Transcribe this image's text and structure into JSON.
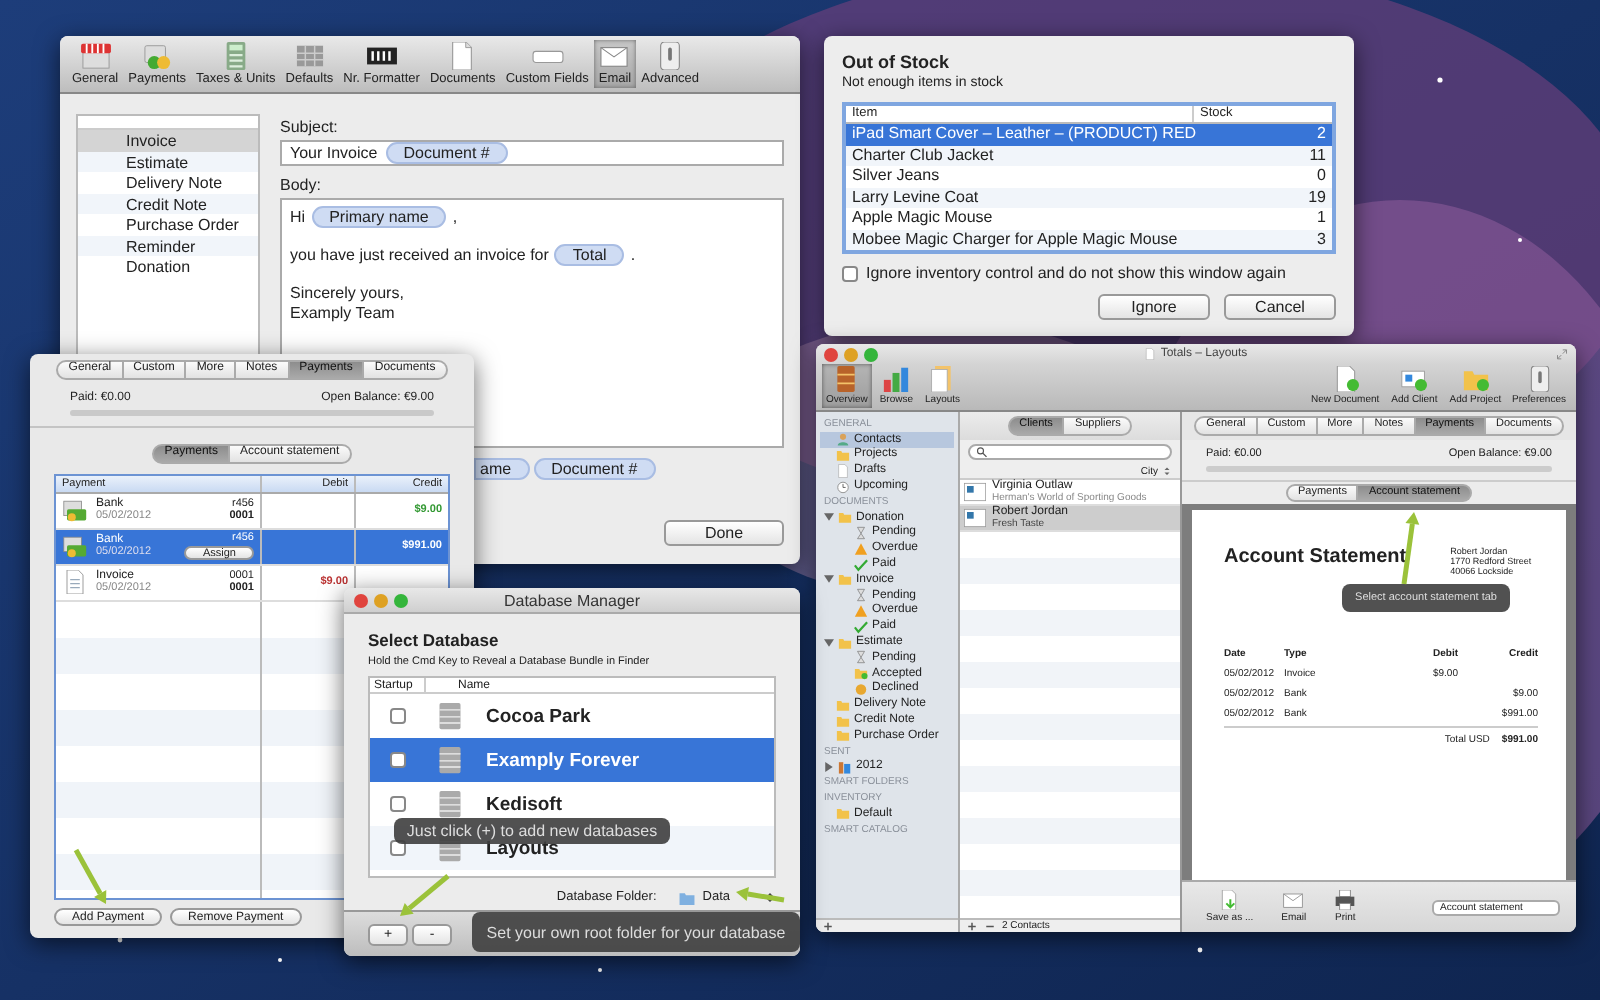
{
  "email_settings": {
    "toolbar": [
      {
        "label": "General",
        "selected": false
      },
      {
        "label": "Payments",
        "selected": false
      },
      {
        "label": "Taxes & Units",
        "selected": false
      },
      {
        "label": "Defaults",
        "selected": false
      },
      {
        "label": "Nr. Formatter",
        "selected": false
      },
      {
        "label": "Documents",
        "selected": false
      },
      {
        "label": "Custom Fields",
        "selected": false
      },
      {
        "label": "Email",
        "selected": true
      },
      {
        "label": "Advanced",
        "selected": false
      }
    ],
    "document_types": [
      {
        "label": "Invoice",
        "selected": true
      },
      {
        "label": "Estimate",
        "selected": false
      },
      {
        "label": "Delivery Note",
        "selected": false
      },
      {
        "label": "Credit Note",
        "selected": false
      },
      {
        "label": "Purchase Order",
        "selected": false
      },
      {
        "label": "Reminder",
        "selected": false
      },
      {
        "label": "Donation",
        "selected": false
      }
    ],
    "subject_label": "Subject:",
    "subject": [
      {
        "kind": "text",
        "text": "Your Invoice"
      },
      {
        "kind": "token",
        "text": "Document #"
      }
    ],
    "body_label": "Body:",
    "body_lines": [
      [
        {
          "kind": "text",
          "text": "Hi"
        },
        {
          "kind": "token",
          "text": "Primary name"
        },
        {
          "kind": "text",
          "text": ","
        }
      ],
      [
        {
          "kind": "text",
          "text": "you have just received an invoice for"
        },
        {
          "kind": "token",
          "text": "Total"
        },
        {
          "kind": "text",
          "text": "."
        }
      ],
      [
        {
          "kind": "text",
          "text": "Sincerely yours,"
        }
      ],
      [
        {
          "kind": "text",
          "text": "Examply Team"
        }
      ]
    ],
    "lower_line": [
      {
        "kind": "token",
        "text": "ame"
      },
      {
        "kind": "token",
        "text": "Document #"
      }
    ],
    "done_button": "Done"
  },
  "out_of_stock": {
    "title": "Out of Stock",
    "subtitle": "Not enough items in stock",
    "columns": [
      "Item",
      "Stock"
    ],
    "rows": [
      {
        "item": "iPad Smart Cover – Leather – (PRODUCT) RED",
        "stock": "2",
        "selected": true
      },
      {
        "item": "Charter Club Jacket",
        "stock": "11",
        "selected": false
      },
      {
        "item": "Silver Jeans",
        "stock": "0",
        "selected": false
      },
      {
        "item": "Larry Levine Coat",
        "stock": "19",
        "selected": false
      },
      {
        "item": "Apple Magic Mouse",
        "stock": "1",
        "selected": false
      },
      {
        "item": "Mobee Magic Charger for Apple Magic Mouse",
        "stock": "3",
        "selected": false
      }
    ],
    "ignore_checkbox": {
      "label": "Ignore inventory control and do not show this window again",
      "checked": false
    },
    "buttons": [
      "Ignore",
      "Cancel"
    ]
  },
  "payments_window": {
    "tabs": [
      {
        "label": "General",
        "selected": false
      },
      {
        "label": "Custom",
        "selected": false
      },
      {
        "label": "More",
        "selected": false
      },
      {
        "label": "Notes",
        "selected": false
      },
      {
        "label": "Payments",
        "selected": true
      },
      {
        "label": "Documents",
        "selected": false
      }
    ],
    "paid": "Paid: €0.00",
    "open_balance": "Open Balance: €9.00",
    "views": [
      {
        "label": "Payments",
        "selected": true
      },
      {
        "label": "Account statement",
        "selected": false
      }
    ],
    "columns": [
      "Payment",
      "Debit",
      "Credit"
    ],
    "rows": [
      {
        "kind": "bank",
        "name": "Bank",
        "date": "05/02/2012",
        "reference": "r456",
        "number": "0001",
        "credit": "$9.00",
        "selected": false
      },
      {
        "kind": "bank",
        "name": "Bank",
        "date": "05/02/2012",
        "reference": "r456",
        "assign_button": "Assign",
        "credit": "$991.00",
        "selected": true
      },
      {
        "kind": "invoice",
        "name": "Invoice",
        "date": "05/02/2012",
        "reference": "0001",
        "number": "0001",
        "debit": "$9.00",
        "selected": false
      }
    ],
    "buttons": [
      "Add Payment",
      "Remove Payment"
    ]
  },
  "database_manager": {
    "title": "Database Manager",
    "heading": "Select Database",
    "hint": "Hold the Cmd Key to Reveal a Database Bundle in Finder",
    "columns": [
      "Startup",
      "Name"
    ],
    "databases": [
      {
        "name": "Cocoa Park",
        "startup": false,
        "selected": false
      },
      {
        "name": "Examply Forever",
        "startup": false,
        "selected": true
      },
      {
        "name": "Kedisoft",
        "startup": false,
        "selected": false
      },
      {
        "name": "Layouts",
        "startup": false,
        "selected": false
      }
    ],
    "folder_label": "Database Folder:",
    "folder": "Data",
    "buttons": [
      "+",
      "-"
    ],
    "tips": [
      "Just click (+) to add new databases",
      "Set your own root folder for your database"
    ]
  },
  "totals_window": {
    "title": "Totals – Layouts",
    "toolbar_left": [
      {
        "label": "Overview",
        "selected": true
      },
      {
        "label": "Browse",
        "selected": false
      },
      {
        "label": "Layouts",
        "selected": false
      }
    ],
    "toolbar_center": [
      "New Document",
      "Add Client",
      "Add Project"
    ],
    "toolbar_right": "Preferences",
    "sidebar": [
      {
        "heading": "GENERAL",
        "items": [
          {
            "label": "Contacts",
            "kind": "contacts",
            "selected": true
          },
          {
            "label": "Projects",
            "kind": "folder",
            "selected": false
          },
          {
            "label": "Drafts",
            "kind": "drafts",
            "selected": false
          },
          {
            "label": "Upcoming",
            "kind": "upcoming",
            "selected": false
          }
        ]
      },
      {
        "heading": "DOCUMENTS",
        "items": [
          {
            "label": "Donation",
            "kind": "folder",
            "selected": false,
            "expanded": true,
            "children": [
              {
                "label": "Pending",
                "kind": "pending",
                "selected": false
              },
              {
                "label": "Overdue",
                "kind": "overdue",
                "selected": false
              },
              {
                "label": "Paid",
                "kind": "paid",
                "selected": false
              }
            ]
          },
          {
            "label": "Invoice",
            "kind": "folder",
            "selected": false,
            "expanded": true,
            "children": [
              {
                "label": "Pending",
                "kind": "pending",
                "selected": false
              },
              {
                "label": "Overdue",
                "kind": "overdue",
                "selected": false
              },
              {
                "label": "Paid",
                "kind": "paid",
                "selected": false
              }
            ]
          },
          {
            "label": "Estimate",
            "kind": "folder",
            "selected": false,
            "expanded": true,
            "children": [
              {
                "label": "Pending",
                "kind": "pending",
                "selected": false
              },
              {
                "label": "Accepted",
                "kind": "accepted",
                "selected": false
              },
              {
                "label": "Declined",
                "kind": "declined",
                "selected": false
              }
            ]
          },
          {
            "label": "Delivery Note",
            "kind": "folder",
            "selected": false
          },
          {
            "label": "Credit Note",
            "kind": "folder",
            "selected": false
          },
          {
            "label": "Purchase Order",
            "kind": "folder",
            "selected": false
          }
        ]
      },
      {
        "heading": "SENT",
        "items": [
          {
            "label": "2012",
            "kind": "archive",
            "selected": false,
            "expanded": false
          }
        ]
      },
      {
        "heading": "SMART FOLDERS"
      },
      {
        "heading": "INVENTORY",
        "items": [
          {
            "label": "Default",
            "kind": "folder",
            "selected": false
          }
        ]
      },
      {
        "heading": "SMART CATALOG"
      }
    ],
    "list_views": [
      {
        "label": "Clients",
        "selected": true
      },
      {
        "label": "Suppliers",
        "selected": false
      }
    ],
    "sort_label": "City",
    "contacts": [
      {
        "name": "Virginia Outlaw",
        "company": "Herman's World of Sporting Goods",
        "selected": false
      },
      {
        "name": "Robert Jordan",
        "company": "Fresh Taste",
        "selected": true
      }
    ],
    "contact_count": "2 Contacts",
    "tabs": [
      {
        "label": "General",
        "selected": false
      },
      {
        "label": "Custom",
        "selected": false
      },
      {
        "label": "More",
        "selected": false
      },
      {
        "label": "Notes",
        "selected": false
      },
      {
        "label": "Payments",
        "selected": true
      },
      {
        "label": "Documents",
        "selected": false
      }
    ],
    "paid": "Paid: €0.00",
    "open_balance": "Open Balance: €9.00",
    "views": [
      {
        "label": "Payments",
        "selected": false
      },
      {
        "label": "Account statement",
        "selected": true
      }
    ],
    "statement": {
      "title": "Account Statement",
      "address": [
        "Robert Jordan",
        "1770 Redford Street",
        "40066 Lockside"
      ],
      "columns": [
        "Date",
        "Type",
        "Debit",
        "Credit"
      ],
      "rows": [
        {
          "date": "05/02/2012",
          "type": "Invoice",
          "debit": "$9.00"
        },
        {
          "date": "05/02/2012",
          "type": "Bank",
          "credit": "$9.00"
        },
        {
          "date": "05/02/2012",
          "type": "Bank",
          "credit": "$991.00"
        }
      ],
      "total_label": "Total USD",
      "total": "$991.00"
    },
    "tip": "Select account statement tab",
    "actions": [
      "Save as ...",
      "Email",
      "Print"
    ],
    "layout_popup": "Account statement"
  }
}
